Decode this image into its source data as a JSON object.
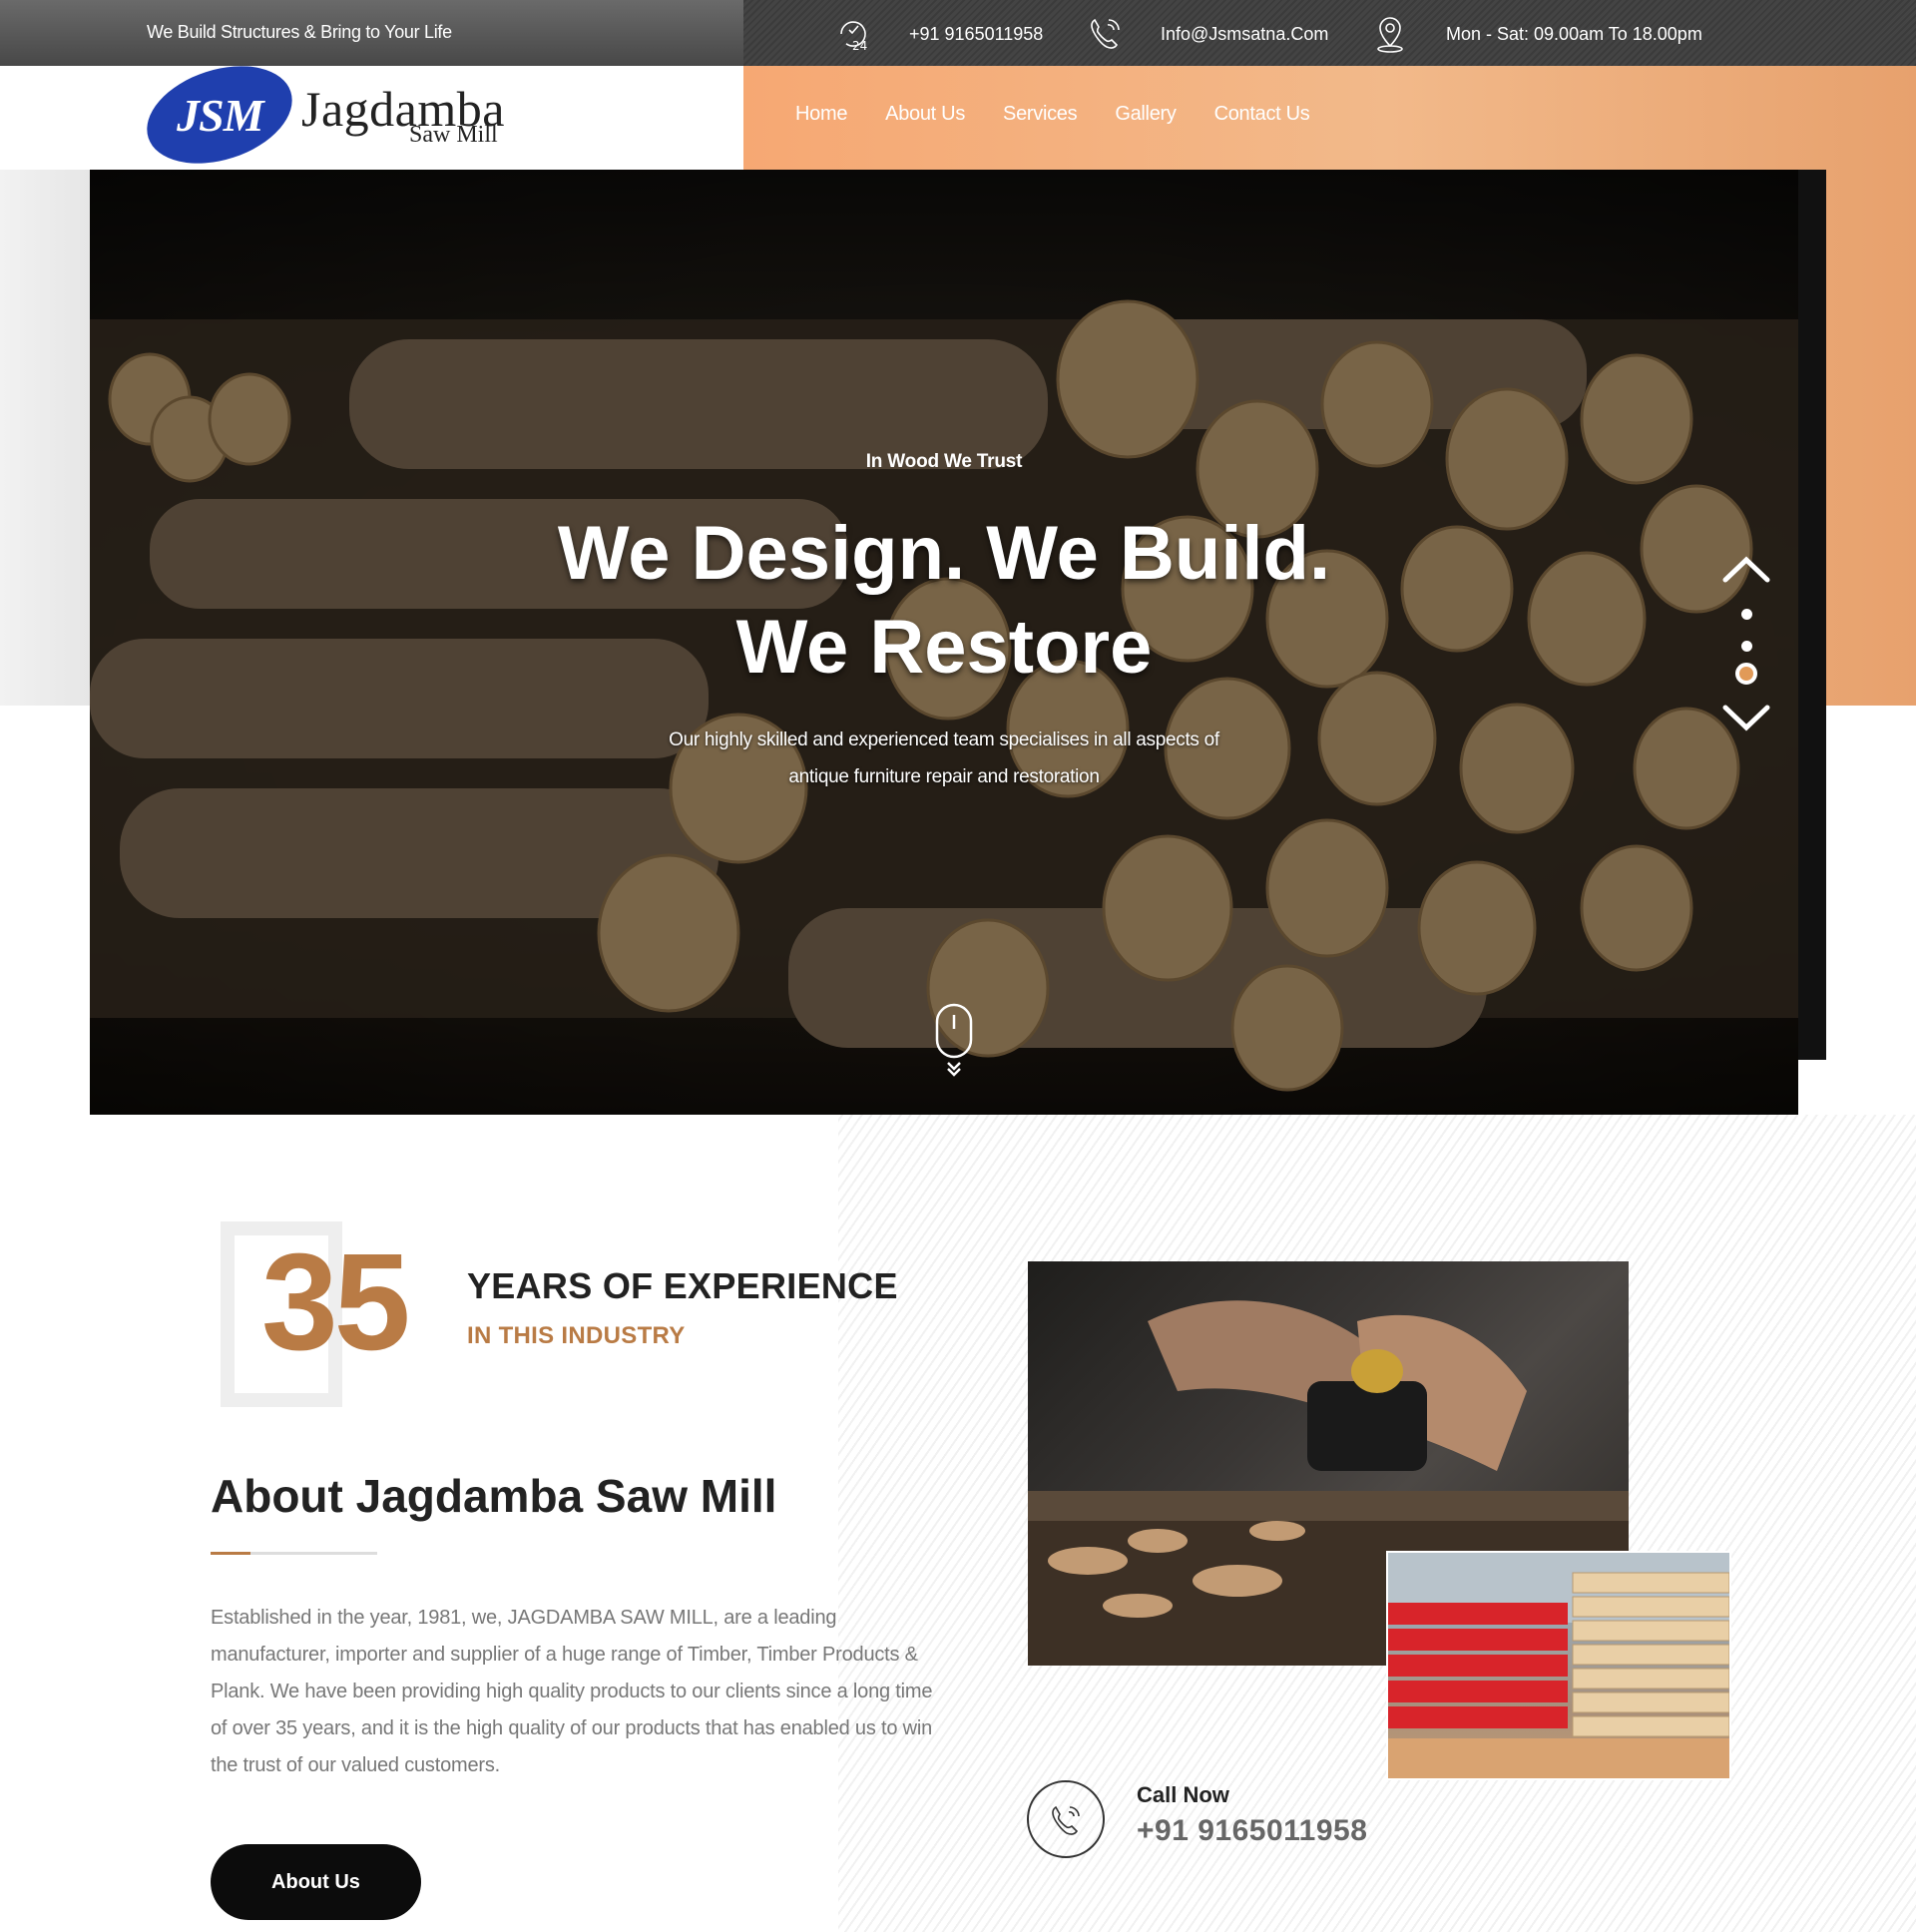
{
  "topbar": {
    "tagline": "We Build Structures & Bring to Your Life",
    "phone": "+91 9165011958",
    "email": "Info@Jsmsatna.Com",
    "hours": "Mon - Sat: 09.00am To 18.00pm",
    "icons": {
      "phone": "24-hour-clock-icon",
      "email": "phone-call-icon",
      "hours": "location-pin-icon"
    }
  },
  "logo": {
    "mark": "JSM",
    "name": "Jagdamba",
    "subname": "Saw Mill"
  },
  "nav": [
    "Home",
    "About Us",
    "Services",
    "Gallery",
    "Contact Us"
  ],
  "hero": {
    "kicker": "In Wood We Trust",
    "headline_line1": "We Design. We Build.",
    "headline_line2": "We Restore",
    "subtext_line1": "Our highly skilled and experienced team specialises in all aspects of",
    "subtext_line2": "antique furniture repair and restoration",
    "slides_total": 3,
    "active_slide": 3
  },
  "about": {
    "years": "35",
    "exp_title": "YEARS OF EXPERIENCE",
    "exp_sub": "IN THIS INDUSTRY",
    "title": "About Jagdamba Saw Mill",
    "paragraph": "Established in the year, 1981, we, JAGDAMBA SAW MILL, are a leading manufacturer, importer and supplier of a huge range of Timber, Timber Products & Plank. We have been providing high quality products to our clients since a long time of over 35 years, and it is the high quality of our products that has enabled us to win the trust of our valued customers.",
    "button": "About Us",
    "call_label": "Call Now",
    "call_number": "+91 9165011958"
  },
  "colors": {
    "accent": "#b97b45",
    "header_orange": "#f6a873",
    "topbar_dark": "#3b3b3b",
    "button_dark": "#0c0c0c"
  }
}
